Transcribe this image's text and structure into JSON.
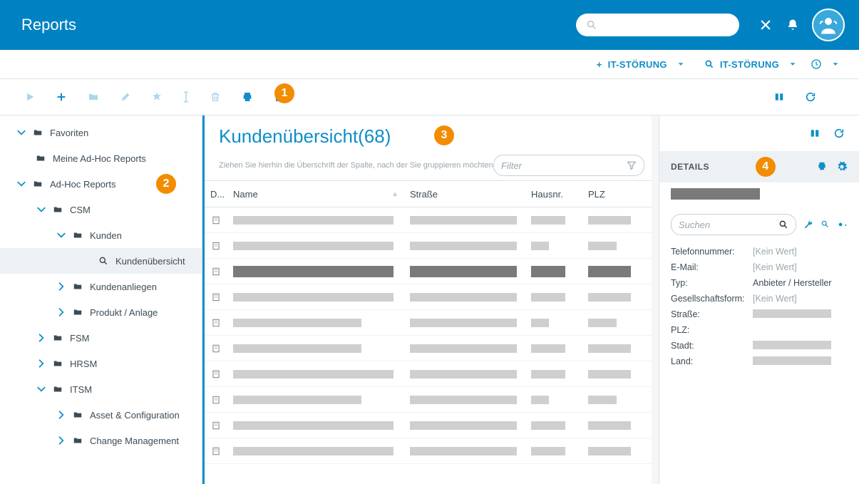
{
  "app": {
    "title": "Reports"
  },
  "header_actions": {
    "create_label": "IT-STÖRUNG",
    "search_label": "IT-STÖRUNG"
  },
  "markers": {
    "m1": "1",
    "m2": "2",
    "m3": "3",
    "m4": "4"
  },
  "sidebar": {
    "favorites": "Favoriten",
    "my_adhoc": "Meine Ad-Hoc Reports",
    "adhoc": "Ad-Hoc Reports",
    "csm": "CSM",
    "kunden": "Kunden",
    "kundenuebersicht": "Kundenübersicht",
    "kundenanliegen": "Kundenanliegen",
    "produkt": "Produkt / Anlage",
    "fsm": "FSM",
    "hrsm": "HRSM",
    "itsm": "ITSM",
    "asset": "Asset & Configuration",
    "change": "Change Management"
  },
  "center": {
    "title": "Kundenübersicht(68)",
    "group_hint": "Ziehen Sie hierhin die Überschrift der Spalte, nach der Sie gruppieren möchten",
    "filter_placeholder": "Filter",
    "columns": {
      "icon": "D...",
      "name": "Name",
      "street": "Straße",
      "houseno": "Hausnr.",
      "zip": "PLZ"
    },
    "rows": [
      {
        "sel": false,
        "name_w": 225,
        "str_w": 150,
        "haus_w": 48,
        "plz_w": 60
      },
      {
        "sel": false,
        "name_w": 225,
        "str_w": 150,
        "haus_w": 25,
        "plz_w": 40
      },
      {
        "sel": true,
        "name_w": 225,
        "str_w": 150,
        "haus_w": 48,
        "plz_w": 60
      },
      {
        "sel": false,
        "name_w": 225,
        "str_w": 150,
        "haus_w": 48,
        "plz_w": 60
      },
      {
        "sel": false,
        "name_w": 180,
        "str_w": 150,
        "haus_w": 25,
        "plz_w": 40
      },
      {
        "sel": false,
        "name_w": 180,
        "str_w": 150,
        "haus_w": 48,
        "plz_w": 60
      },
      {
        "sel": false,
        "name_w": 225,
        "str_w": 150,
        "haus_w": 48,
        "plz_w": 60
      },
      {
        "sel": false,
        "name_w": 180,
        "str_w": 150,
        "haus_w": 25,
        "plz_w": 40
      },
      {
        "sel": false,
        "name_w": 225,
        "str_w": 150,
        "haus_w": 48,
        "plz_w": 60
      },
      {
        "sel": false,
        "name_w": 225,
        "str_w": 150,
        "haus_w": 48,
        "plz_w": 60
      }
    ]
  },
  "details": {
    "heading": "DETAILS",
    "search_placeholder": "Suchen",
    "no_value": "[Kein Wert]",
    "fields": {
      "phone_label": "Telefonnummer:",
      "email_label": "E-Mail:",
      "typ_label": "Typ:",
      "typ_value": "Anbieter / Hersteller",
      "gesell_label": "Gesellschaftsform:",
      "street_label": "Straße:",
      "plz_label": "PLZ:",
      "stadt_label": "Stadt:",
      "land_label": "Land:"
    }
  }
}
